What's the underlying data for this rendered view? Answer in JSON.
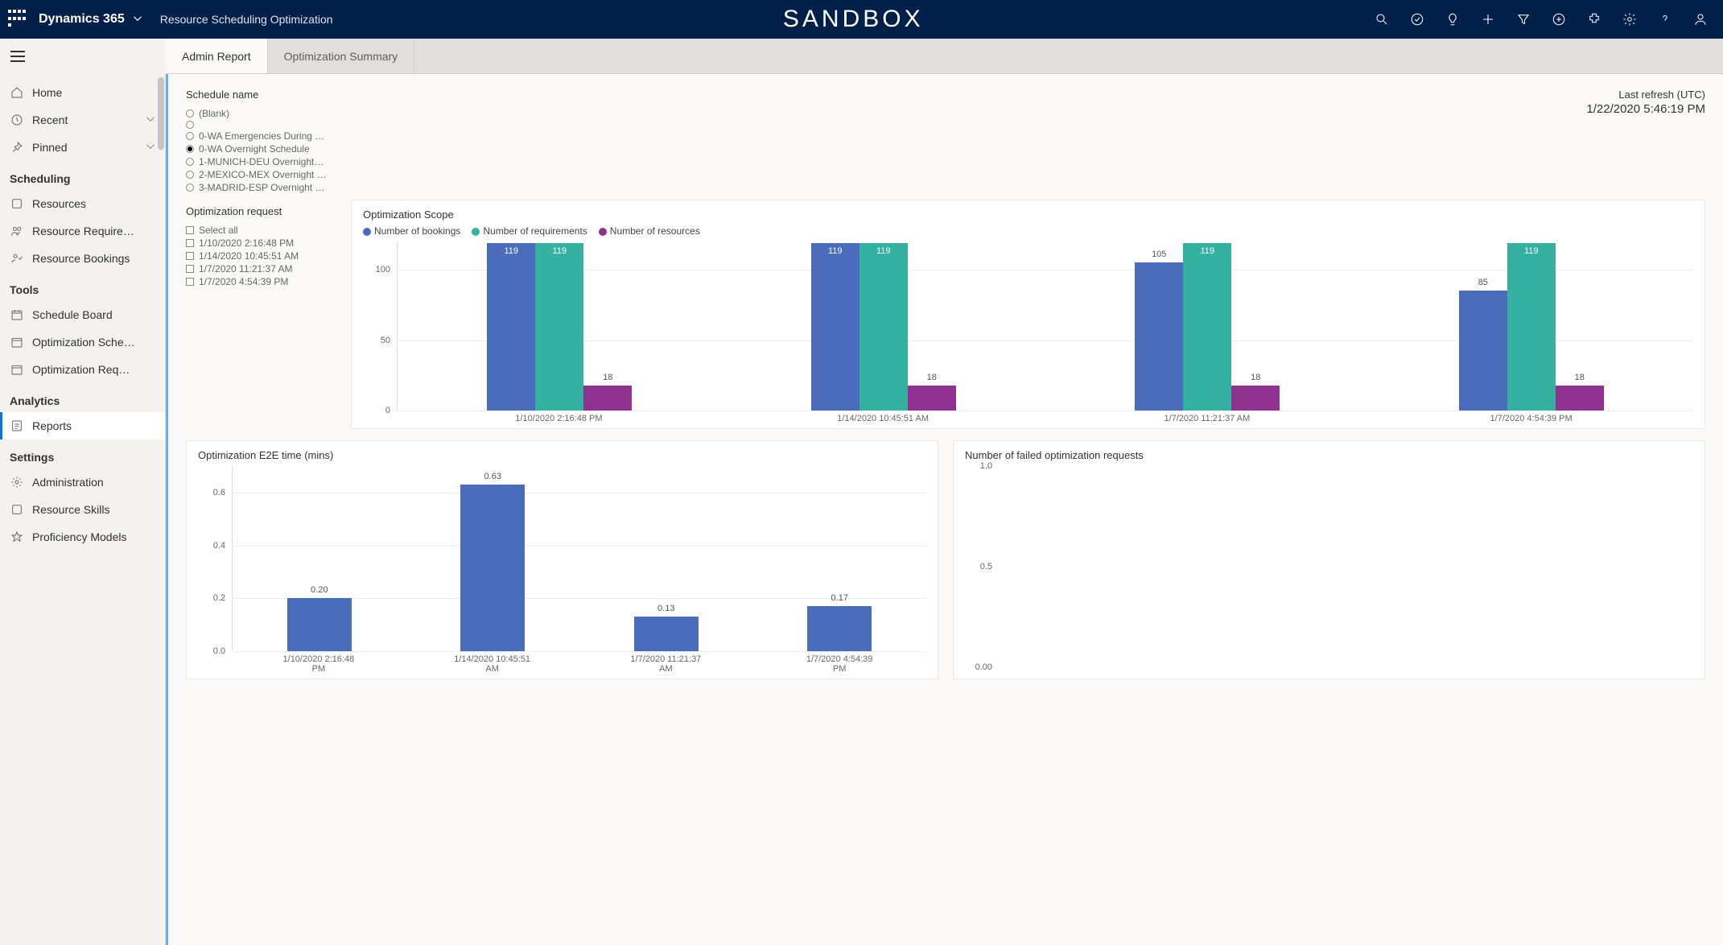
{
  "header": {
    "app": "Dynamics 365",
    "area": "Resource Scheduling Optimization",
    "env": "SANDBOX"
  },
  "tabs": {
    "admin": "Admin Report",
    "summary": "Optimization Summary"
  },
  "nav": {
    "home": "Home",
    "recent": "Recent",
    "pinned": "Pinned",
    "sec_scheduling": "Scheduling",
    "resources": "Resources",
    "resource_requirements": "Resource Require…",
    "resource_bookings": "Resource Bookings",
    "sec_tools": "Tools",
    "schedule_board": "Schedule Board",
    "optimization_schedules": "Optimization Sche…",
    "optimization_requests": "Optimization Req…",
    "sec_analytics": "Analytics",
    "reports": "Reports",
    "sec_settings": "Settings",
    "administration": "Administration",
    "resource_skills": "Resource Skills",
    "proficiency_models": "Proficiency Models"
  },
  "filters": {
    "schedule_label": "Schedule name",
    "schedules": [
      {
        "label": "(Blank)",
        "selected": false
      },
      {
        "label": "",
        "selected": false
      },
      {
        "label": "0-WA Emergencies During …",
        "selected": false
      },
      {
        "label": "0-WA Overnight Schedule",
        "selected": true
      },
      {
        "label": "1-MUNICH-DEU Overnight…",
        "selected": false
      },
      {
        "label": "2-MEXICO-MEX Overnight …",
        "selected": false
      },
      {
        "label": "3-MADRID-ESP Overnight …",
        "selected": false
      }
    ],
    "request_label": "Optimization request",
    "select_all": "Select all",
    "requests": [
      "1/10/2020 2:16:48 PM",
      "1/14/2020 10:45:51 AM",
      "1/7/2020 11:21:37 AM",
      "1/7/2020 4:54:39 PM"
    ]
  },
  "refresh": {
    "label": "Last refresh (UTC)",
    "value": "1/22/2020 5:46:19 PM"
  },
  "chart_data": [
    {
      "type": "bar",
      "title": "Optimization Scope",
      "legend": [
        "Number of bookings",
        "Number of requirements",
        "Number of resources"
      ],
      "colors": [
        "#4a6cba",
        "#34b1a0",
        "#91318f"
      ],
      "categories": [
        "1/10/2020 2:16:48 PM",
        "1/14/2020 10:45:51 AM",
        "1/7/2020 11:21:37 AM",
        "1/7/2020 4:54:39 PM"
      ],
      "series": [
        {
          "name": "Number of bookings",
          "values": [
            119,
            119,
            105,
            85
          ]
        },
        {
          "name": "Number of requirements",
          "values": [
            119,
            119,
            119,
            119
          ]
        },
        {
          "name": "Number of resources",
          "values": [
            18,
            18,
            18,
            18
          ]
        }
      ],
      "ylim": [
        0,
        120
      ],
      "yticks": [
        0,
        50,
        100
      ]
    },
    {
      "type": "bar",
      "title": "Optimization E2E time (mins)",
      "categories": [
        "1/10/2020 2:16:48 PM",
        "1/14/2020 10:45:51 AM",
        "1/7/2020 11:21:37 AM",
        "1/7/2020 4:54:39 PM"
      ],
      "values": [
        0.2,
        0.63,
        0.13,
        0.17
      ],
      "color": "#4a6cba",
      "ylim": [
        0,
        0.7
      ],
      "yticks": [
        0.0,
        0.2,
        0.4,
        0.6
      ]
    },
    {
      "type": "bar",
      "title": "Number of failed optimization requests",
      "categories": [],
      "values": [],
      "ylim": [
        0,
        1.0
      ],
      "yticks": [
        0.0,
        0.5,
        1.0
      ]
    }
  ]
}
